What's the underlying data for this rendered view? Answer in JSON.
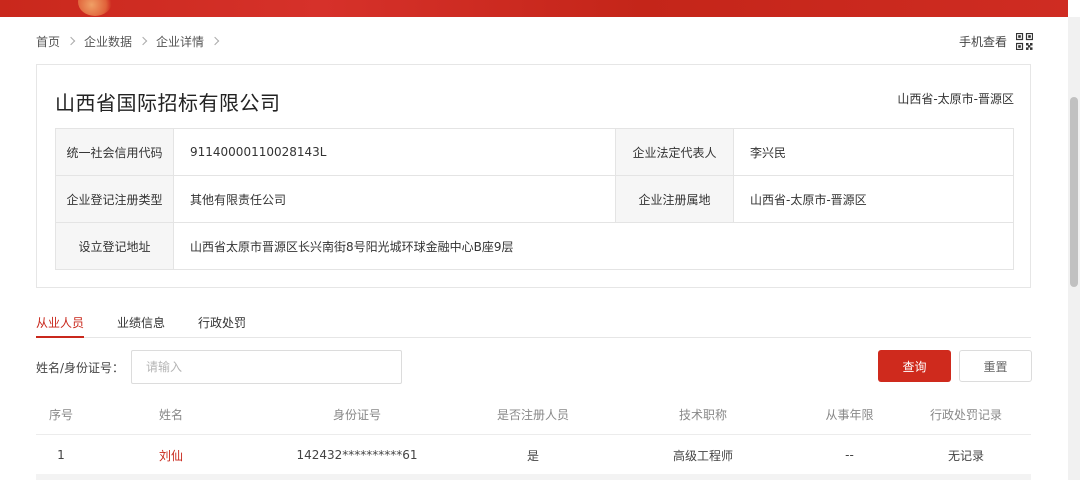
{
  "breadcrumb": {
    "items": [
      "首页",
      "企业数据",
      "企业详情"
    ]
  },
  "header": {
    "mobile_view_label": "手机查看",
    "icon": "qr-code-icon"
  },
  "company": {
    "name": "山西省国际招标有限公司",
    "region": "山西省-太原市-晋源区",
    "fields": {
      "credit_code_label": "统一社会信用代码",
      "credit_code": "91140000110028143L",
      "legal_rep_label": "企业法定代表人",
      "legal_rep": "李兴民",
      "reg_type_label": "企业登记注册类型",
      "reg_type": "其他有限责任公司",
      "reg_place_label": "企业注册属地",
      "reg_place": "山西省-太原市-晋源区",
      "address_label": "设立登记地址",
      "address": "山西省太原市晋源区长兴南街8号阳光城环球金融中心B座9层"
    }
  },
  "tabs": [
    "从业人员",
    "业绩信息",
    "行政处罚"
  ],
  "active_tab": 0,
  "search": {
    "label": "姓名/身份证号：",
    "placeholder": "请输入",
    "value": "",
    "query_button": "查询",
    "reset_button": "重置"
  },
  "table": {
    "columns": [
      "序号",
      "姓名",
      "身份证号",
      "是否注册人员",
      "技术职称",
      "从事年限",
      "行政处罚记录"
    ],
    "rows": [
      [
        "1",
        "刘仙",
        "142432**********61",
        "是",
        "高级工程师",
        "--",
        "无记录"
      ]
    ]
  },
  "colors": {
    "accent": "#c9281c",
    "banner": "#d6312a"
  }
}
